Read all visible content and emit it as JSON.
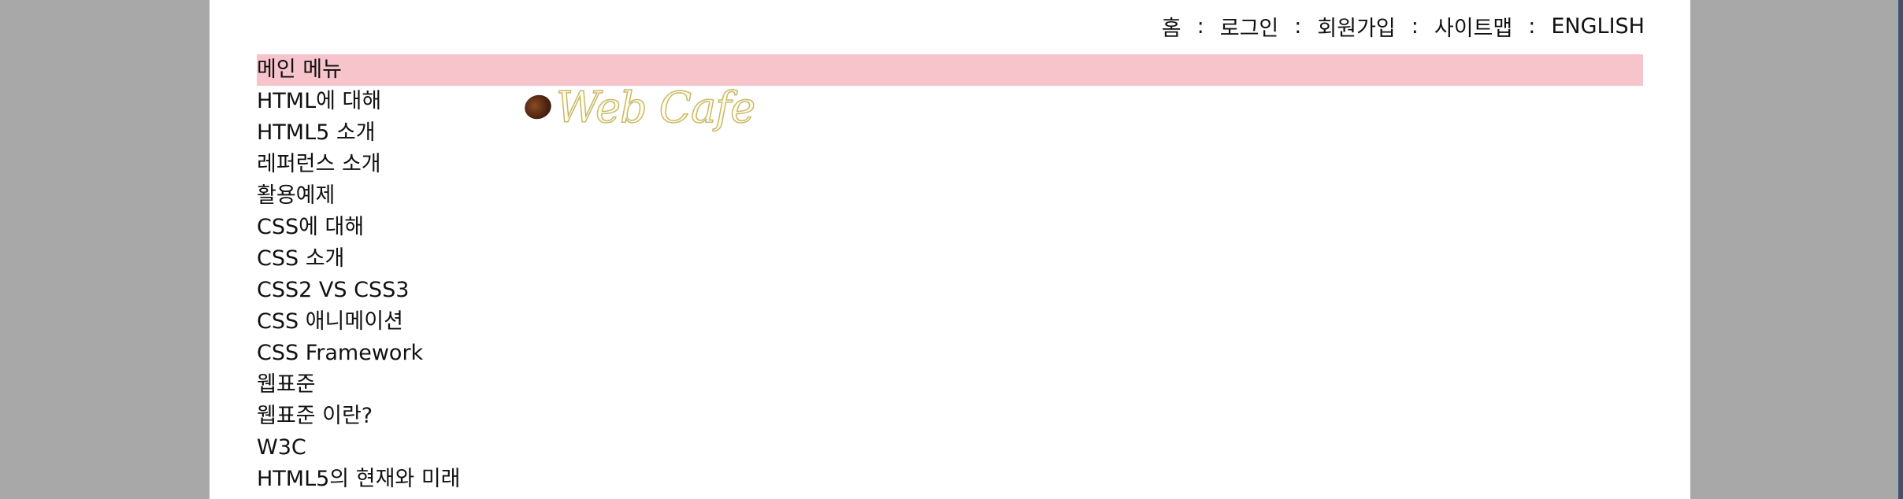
{
  "util_nav": {
    "home": "홈",
    "login": "로그인",
    "signup": "회원가입",
    "sitemap": "사이트맵",
    "english": "ENGLISH",
    "separator": ":"
  },
  "logo": {
    "text": "Web Cafe"
  },
  "menu": {
    "header": "메인 메뉴",
    "items": [
      "HTML에 대해",
      "HTML5 소개",
      "레퍼런스 소개",
      "활용예제",
      "CSS에 대해",
      "CSS 소개",
      "CSS2 VS CSS3",
      "CSS 애니메이션",
      "CSS Framework",
      "웹표준",
      "웹표준 이란?",
      "W3C",
      "HTML5의 현재와 미래"
    ]
  },
  "colors": {
    "background": "#a8a8a8",
    "page": "#ffffff",
    "menu_header": "#f7c4cc"
  }
}
